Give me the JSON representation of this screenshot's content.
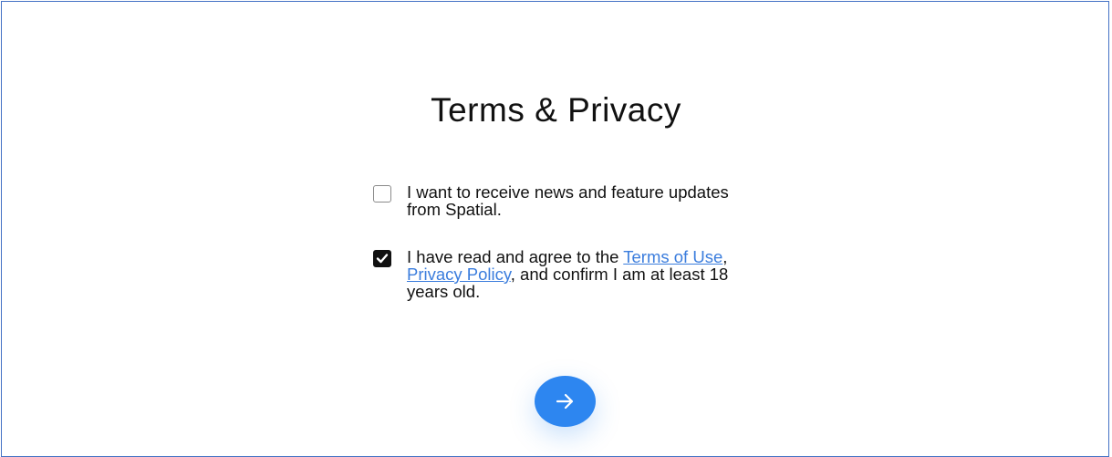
{
  "page": {
    "title": "Terms & Privacy"
  },
  "options": {
    "news": {
      "checked": false,
      "label": "I want to receive news and feature updates from Spatial."
    },
    "terms": {
      "checked": true,
      "text_before": "I have read and agree to the ",
      "terms_link": "Terms of Use",
      "separator": ", ",
      "privacy_link": "Privacy Policy",
      "text_after": ", and confirm I am at least 18 years old."
    }
  },
  "next_button": {
    "icon": "arrow-right-icon"
  },
  "colors": {
    "accent": "#2d86f0",
    "link": "#3b7ddd",
    "frame": "#4472c4"
  }
}
